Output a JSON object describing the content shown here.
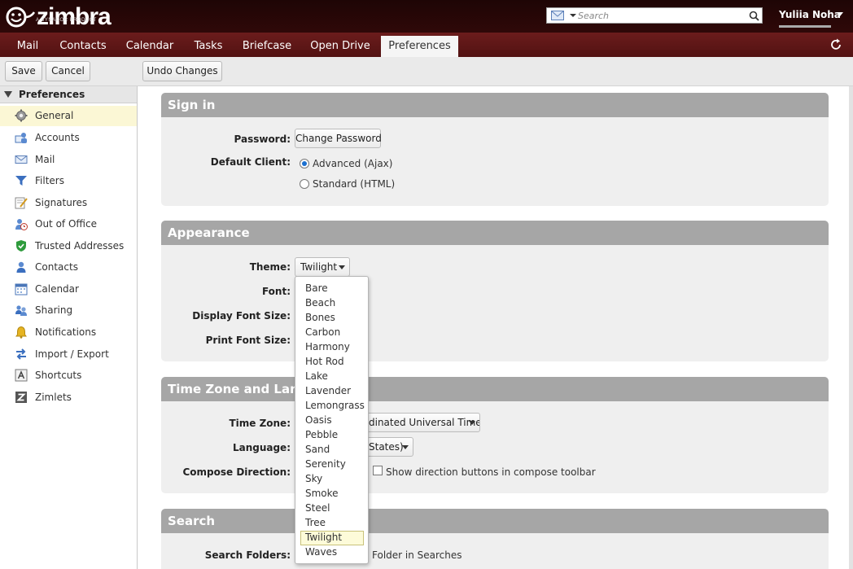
{
  "app": {
    "logo_text": "zimbra",
    "logo_sub": "A SYNACOR PRODUCT"
  },
  "search": {
    "placeholder": "Search"
  },
  "user": {
    "name": "Yuliia Noha"
  },
  "tabs": [
    {
      "label": "Mail"
    },
    {
      "label": "Contacts"
    },
    {
      "label": "Calendar"
    },
    {
      "label": "Tasks"
    },
    {
      "label": "Briefcase"
    },
    {
      "label": "Open Drive"
    },
    {
      "label": "Preferences",
      "active": true
    }
  ],
  "toolbar": {
    "save": "Save",
    "cancel": "Cancel",
    "undo": "Undo Changes"
  },
  "sidebar": {
    "header": "Preferences",
    "items": [
      {
        "label": "General",
        "icon": "gear-icon",
        "selected": true
      },
      {
        "label": "Accounts",
        "icon": "accounts-icon"
      },
      {
        "label": "Mail",
        "icon": "mail-icon"
      },
      {
        "label": "Filters",
        "icon": "filter-icon"
      },
      {
        "label": "Signatures",
        "icon": "signature-icon"
      },
      {
        "label": "Out of Office",
        "icon": "out-of-office-icon"
      },
      {
        "label": "Trusted Addresses",
        "icon": "shield-icon"
      },
      {
        "label": "Contacts",
        "icon": "contact-icon"
      },
      {
        "label": "Calendar",
        "icon": "calendar-icon"
      },
      {
        "label": "Sharing",
        "icon": "sharing-icon"
      },
      {
        "label": "Notifications",
        "icon": "bell-icon"
      },
      {
        "label": "Import / Export",
        "icon": "import-export-icon"
      },
      {
        "label": "Shortcuts",
        "icon": "keyboard-icon"
      },
      {
        "label": "Zimlets",
        "icon": "zimlet-icon"
      }
    ]
  },
  "sections": {
    "signin": {
      "title": "Sign in",
      "password_label": "Password:",
      "change_password": "Change Password",
      "default_client_label": "Default Client:",
      "advanced": "Advanced (Ajax)",
      "standard": "Standard (HTML)",
      "selected_client": "Advanced (Ajax)"
    },
    "appearance": {
      "title": "Appearance",
      "theme_label": "Theme:",
      "theme_value": "Twilight",
      "font_label": "Font:",
      "display_font_label": "Display Font Size:",
      "print_font_label": "Print Font Size:"
    },
    "timezone": {
      "title": "Time Zone and Lang",
      "timezone_label": "Time Zone:",
      "timezone_value": "dinated Universal Time",
      "language_label": "Language:",
      "language_value": "States)",
      "compose_label": "Compose Direction:",
      "compose_checkbox": "Show direction buttons in compose toolbar"
    },
    "search": {
      "title": "Search",
      "folders_label": "Search Folders:",
      "folders_text": "Folder in Searches"
    }
  },
  "theme_dropdown": {
    "options": [
      "Bare",
      "Beach",
      "Bones",
      "Carbon",
      "Harmony",
      "Hot Rod",
      "Lake",
      "Lavender",
      "Lemongrass",
      "Oasis",
      "Pebble",
      "Sand",
      "Serenity",
      "Sky",
      "Smoke",
      "Steel",
      "Tree",
      "Twilight",
      "Waves"
    ],
    "selected": "Twilight"
  }
}
